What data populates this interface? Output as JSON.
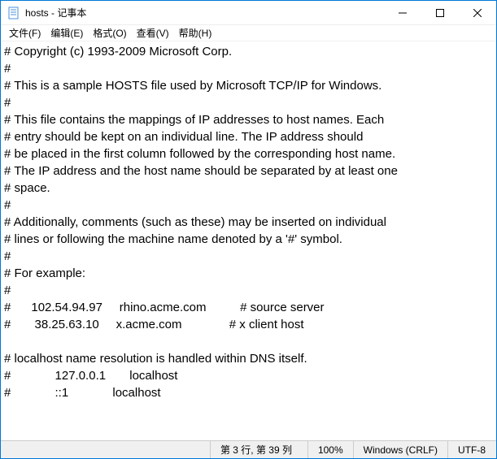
{
  "window": {
    "title": "hosts - 记事本"
  },
  "menu": {
    "file": "文件(F)",
    "edit": "编辑(E)",
    "format": "格式(O)",
    "view": "查看(V)",
    "help": "帮助(H)"
  },
  "content": "# Copyright (c) 1993-2009 Microsoft Corp.\n#\n# This is a sample HOSTS file used by Microsoft TCP/IP for Windows.\n#\n# This file contains the mappings of IP addresses to host names. Each\n# entry should be kept on an individual line. The IP address should\n# be placed in the first column followed by the corresponding host name.\n# The IP address and the host name should be separated by at least one\n# space.\n#\n# Additionally, comments (such as these) may be inserted on individual\n# lines or following the machine name denoted by a '#' symbol.\n#\n# For example:\n#\n#      102.54.94.97     rhino.acme.com          # source server\n#       38.25.63.10     x.acme.com              # x client host\n\n# localhost name resolution is handled within DNS itself.\n#             127.0.0.1       localhost\n#             ::1             localhost",
  "status": {
    "position": "第 3 行, 第 39 列",
    "zoom": "100%",
    "eol": "Windows (CRLF)",
    "encoding": "UTF-8"
  }
}
